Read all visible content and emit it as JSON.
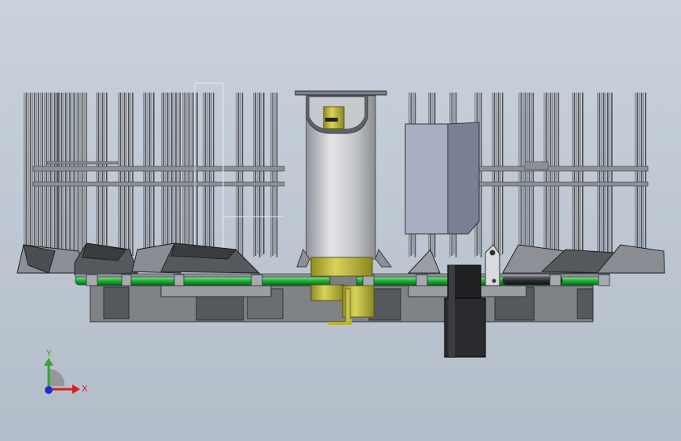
{
  "view": {
    "background_top": "#c9d2dc",
    "background_bottom": "#b3bdc9"
  },
  "triad": {
    "y_label": "Y",
    "x_label": "X",
    "y_color": "#2fa82f",
    "x_color": "#d62020",
    "z_color": "#1a2fd0"
  },
  "colors": {
    "frame": "#6e7278",
    "frame_dark": "#3c3f44",
    "cylinder": "#c9cbd0",
    "box": "#9ea4b8",
    "rail": "#2ec043",
    "shaft": "#b8b334",
    "motor": "#1f2022",
    "base": "#7a7d82"
  }
}
